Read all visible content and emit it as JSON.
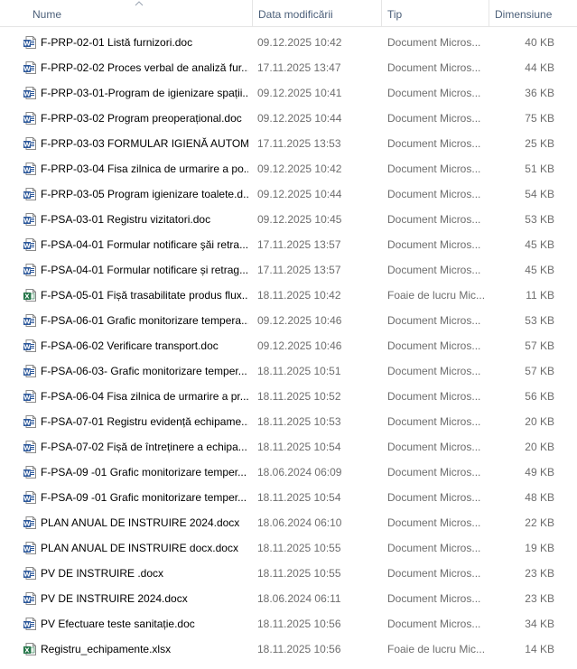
{
  "columns": {
    "name": "Nume",
    "date": "Data modificării",
    "type": "Tip",
    "size": "Dimensiune"
  },
  "colors": {
    "word": "#2b579a",
    "excel": "#217346",
    "header_text": "#4c607a"
  },
  "files": [
    {
      "name": "F-PRP-02-01 Listă furnizori.doc",
      "date": "09.12.2025 10:42",
      "type": "Document Micros...",
      "size": "40 KB",
      "icon": "word-doc-icon"
    },
    {
      "name": "F-PRP-02-02 Proces verbal de analiză fur...",
      "date": "17.11.2025 13:47",
      "type": "Document Micros...",
      "size": "44 KB",
      "icon": "word-doc-icon"
    },
    {
      "name": "F-PRP-03-01-Program de igienizare spații...",
      "date": "09.12.2025 10:41",
      "type": "Document Micros...",
      "size": "36 KB",
      "icon": "word-doc-icon"
    },
    {
      "name": "F-PRP-03-02 Program preoperațional.doc",
      "date": "09.12.2025 10:44",
      "type": "Document Micros...",
      "size": "75 KB",
      "icon": "word-doc-icon"
    },
    {
      "name": "F-PRP-03-03 FORMULAR IGIENĂ AUTOM...",
      "date": "17.11.2025 13:53",
      "type": "Document Micros...",
      "size": "25 KB",
      "icon": "word-doc-icon"
    },
    {
      "name": "F-PRP-03-04 Fisa zilnica de urmarire a po...",
      "date": "09.12.2025 10:42",
      "type": "Document Micros...",
      "size": "51 KB",
      "icon": "word-doc-icon"
    },
    {
      "name": "F-PRP-03-05 Program igienizare toalete.d...",
      "date": "09.12.2025 10:44",
      "type": "Document Micros...",
      "size": "54 KB",
      "icon": "word-doc-icon"
    },
    {
      "name": "F-PSA-03-01 Registru vizitatori.doc",
      "date": "09.12.2025 10:45",
      "type": "Document Micros...",
      "size": "53 KB",
      "icon": "word-doc-icon"
    },
    {
      "name": "F-PSA-04-01 Formular notificare şăi retra...",
      "date": "17.11.2025 13:57",
      "type": "Document Micros...",
      "size": "45 KB",
      "icon": "word-doc-icon"
    },
    {
      "name": "F-PSA-04-01 Formular notificare și retrag...",
      "date": "17.11.2025 13:57",
      "type": "Document Micros...",
      "size": "45 KB",
      "icon": "word-doc-icon"
    },
    {
      "name": "F-PSA-05-01 Fișă trasabilitate produs flux...",
      "date": "18.11.2025 10:42",
      "type": "Foaie de lucru Mic...",
      "size": "11 KB",
      "icon": "excel-sheet-icon"
    },
    {
      "name": "F-PSA-06-01 Grafic monitorizare tempera...",
      "date": "09.12.2025 10:46",
      "type": "Document Micros...",
      "size": "53 KB",
      "icon": "word-doc-icon"
    },
    {
      "name": "F-PSA-06-02 Verificare transport.doc",
      "date": "09.12.2025 10:46",
      "type": "Document Micros...",
      "size": "57 KB",
      "icon": "word-doc-icon"
    },
    {
      "name": "F-PSA-06-03- Grafic monitorizare temper...",
      "date": "18.11.2025 10:51",
      "type": "Document Micros...",
      "size": "57 KB",
      "icon": "word-doc-icon"
    },
    {
      "name": "F-PSA-06-04 Fisa zilnica de urmarire a pr...",
      "date": "18.11.2025 10:52",
      "type": "Document Micros...",
      "size": "56 KB",
      "icon": "word-doc-icon"
    },
    {
      "name": "F-PSA-07-01 Registru evidență echipame...",
      "date": "18.11.2025 10:53",
      "type": "Document Micros...",
      "size": "20 KB",
      "icon": "word-doc-icon"
    },
    {
      "name": "F-PSA-07-02 Fișă de întreținere a echipa...",
      "date": "18.11.2025 10:54",
      "type": "Document Micros...",
      "size": "20 KB",
      "icon": "word-doc-icon"
    },
    {
      "name": "F-PSA-09 -01 Grafic monitorizare temper...",
      "date": "18.06.2024 06:09",
      "type": "Document Micros...",
      "size": "49 KB",
      "icon": "word-doc-icon"
    },
    {
      "name": "F-PSA-09 -01 Grafic monitorizare temper...",
      "date": "18.11.2025 10:54",
      "type": "Document Micros...",
      "size": "48 KB",
      "icon": "word-doc-icon"
    },
    {
      "name": "PLAN ANUAL DE INSTRUIRE 2024.docx",
      "date": "18.06.2024 06:10",
      "type": "Document Micros...",
      "size": "22 KB",
      "icon": "word-doc-icon"
    },
    {
      "name": "PLAN ANUAL DE INSTRUIRE docx.docx",
      "date": "18.11.2025 10:55",
      "type": "Document Micros...",
      "size": "19 KB",
      "icon": "word-doc-icon"
    },
    {
      "name": "PV DE INSTRUIRE .docx",
      "date": "18.11.2025 10:55",
      "type": "Document Micros...",
      "size": "23 KB",
      "icon": "word-doc-icon"
    },
    {
      "name": "PV DE INSTRUIRE 2024.docx",
      "date": "18.06.2024 06:11",
      "type": "Document Micros...",
      "size": "23 KB",
      "icon": "word-doc-icon"
    },
    {
      "name": "PV Efectuare teste sanitație.doc",
      "date": "18.11.2025 10:56",
      "type": "Document Micros...",
      "size": "34 KB",
      "icon": "word-doc-icon"
    },
    {
      "name": "Registru_echipamente.xlsx",
      "date": "18.11.2025 10:56",
      "type": "Foaie de lucru Mic...",
      "size": "14 KB",
      "icon": "excel-sheet-icon"
    }
  ]
}
